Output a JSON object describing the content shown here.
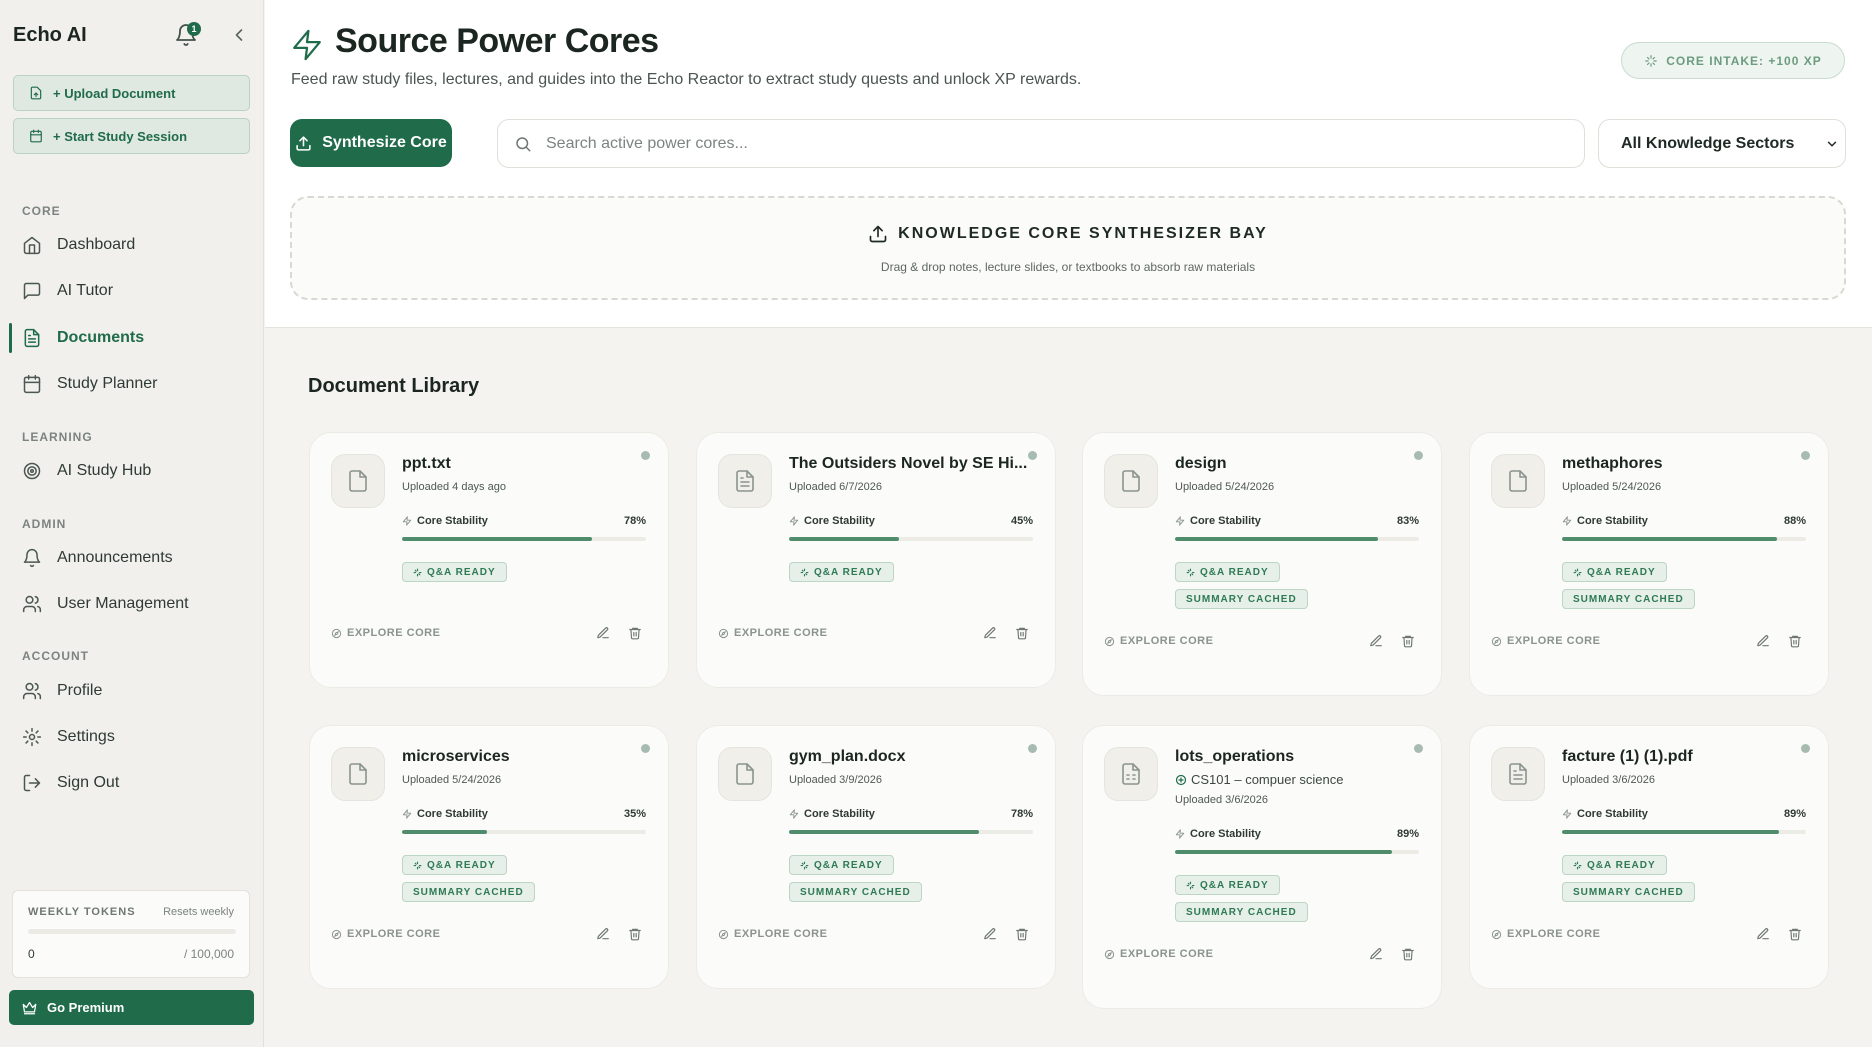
{
  "sidebar": {
    "brand": "Echo AI",
    "notification_count": "1",
    "upload_label": "+ Upload Document",
    "session_label": "+ Start Study Session",
    "sections": {
      "core": "CORE",
      "learning": "LEARNING",
      "admin": "ADMIN",
      "account": "ACCOUNT"
    },
    "nav": {
      "dashboard": "Dashboard",
      "ai_tutor": "AI Tutor",
      "documents": "Documents",
      "study_planner": "Study Planner",
      "study_hub": "AI Study Hub",
      "announcements": "Announcements",
      "user_management": "User Management",
      "profile": "Profile",
      "settings": "Settings",
      "sign_out": "Sign Out"
    },
    "active_item": "Documents",
    "tokens": {
      "label": "WEEKLY TOKENS",
      "resets": "Resets weekly",
      "used": "0",
      "limit": "/ 100,000",
      "progress_fraction": 0
    },
    "premium_label": "Go Premium"
  },
  "header": {
    "title": "Source Power Cores",
    "subtitle": "Feed raw study files, lectures, and guides into the Echo Reactor to extract study quests and unlock XP rewards.",
    "intake_badge": "CORE INTAKE: +100 XP",
    "synth_button": "Synthesize Core",
    "search_placeholder": "Search active power cores...",
    "sector_select": "All Knowledge Sectors",
    "dropzone_title": "KNOWLEDGE CORE SYNTHESIZER BAY",
    "dropzone_subtitle": "Drag & drop notes, lecture slides, or textbooks to absorb raw materials"
  },
  "library": {
    "title": "Document Library",
    "stability_label": "Core Stability",
    "qa_badge": "Q&A READY",
    "summary_badge": "SUMMARY CACHED",
    "explore_label": "EXPLORE CORE",
    "documents": [
      {
        "name": "ppt.txt",
        "course": "",
        "uploaded": "Uploaded 4 days ago",
        "stability": 78,
        "stability_text": "78%",
        "qa": true,
        "summary": false,
        "icon": "file-icon"
      },
      {
        "name": "The Outsiders Novel by SE Hi...",
        "course": "",
        "uploaded": "Uploaded 6/7/2026",
        "stability": 45,
        "stability_text": "45%",
        "qa": true,
        "summary": false,
        "icon": "file-text-icon"
      },
      {
        "name": "design",
        "course": "",
        "uploaded": "Uploaded 5/24/2026",
        "stability": 83,
        "stability_text": "83%",
        "qa": true,
        "summary": true,
        "icon": "file-icon"
      },
      {
        "name": "methaphores",
        "course": "",
        "uploaded": "Uploaded 5/24/2026",
        "stability": 88,
        "stability_text": "88%",
        "qa": true,
        "summary": true,
        "icon": "file-icon"
      },
      {
        "name": "microservices",
        "course": "",
        "uploaded": "Uploaded 5/24/2026",
        "stability": 35,
        "stability_text": "35%",
        "qa": true,
        "summary": true,
        "icon": "file-icon"
      },
      {
        "name": "gym_plan.docx",
        "course": "",
        "uploaded": "Uploaded 3/9/2026",
        "stability": 78,
        "stability_text": "78%",
        "qa": true,
        "summary": true,
        "icon": "file-icon"
      },
      {
        "name": "lots_operations",
        "course": "CS101 – compuer science",
        "uploaded": "Uploaded 3/6/2026",
        "stability": 89,
        "stability_text": "89%",
        "qa": true,
        "summary": true,
        "icon": "file-sheet-icon"
      },
      {
        "name": "facture (1) (1).pdf",
        "course": "",
        "uploaded": "Uploaded 3/6/2026",
        "stability": 89,
        "stability_text": "89%",
        "qa": true,
        "summary": true,
        "icon": "file-text-icon"
      }
    ]
  },
  "colors": {
    "accent": "#1f6b4a",
    "progress": "#4f8c6c",
    "badge_bg": "#e6efe8",
    "background": "#f4f3ef"
  }
}
